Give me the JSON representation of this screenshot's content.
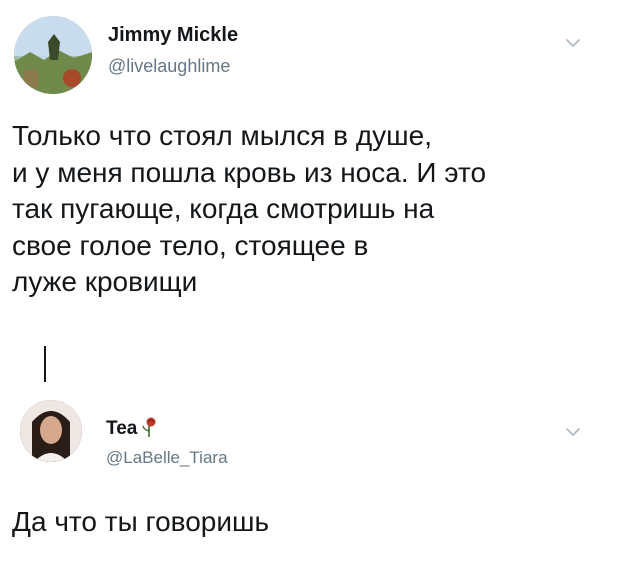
{
  "tweets": [
    {
      "author": {
        "name": "Jimmy Mickle",
        "handle": "@livelaughlime"
      },
      "text_lines": [
        "Только что стоял мылся в душе,",
        "и у меня пошла кровь из носа. И это",
        "так пугающе, когда смотришь на",
        "свое голое тело, стоящее в",
        "луже кровищи"
      ]
    },
    {
      "author": {
        "name": "Tea",
        "handle": "@LaBelle_Tiara"
      },
      "text": "Да что ты говоришь"
    }
  ],
  "icons": {
    "menu": "chevron-down-icon",
    "name_emoji": "rose-icon"
  }
}
